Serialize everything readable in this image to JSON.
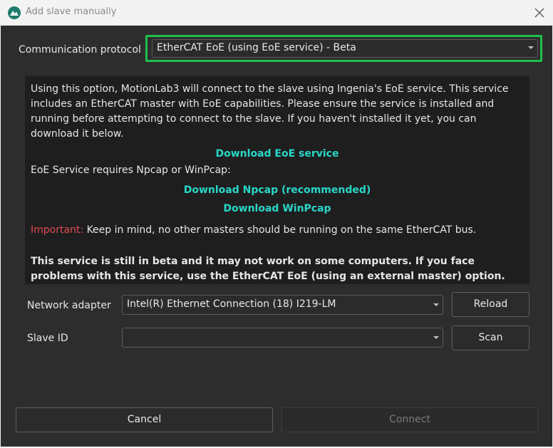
{
  "window": {
    "title": "Add slave manually"
  },
  "protocol": {
    "label": "Communication protocol",
    "value": "EtherCAT EoE (using EoE service) - Beta"
  },
  "info": {
    "intro": "Using this option, MotionLab3 will connect to the slave using Ingenia's EoE service. This service includes an EtherCAT master with EoE capabilities. Please ensure the service is installed and running before attempting to connect to the slave. If you haven't installed it yet, you can download it below.",
    "download_eoe": "Download EoE service",
    "requires": "EoE Service requires Npcap or WinPcap:",
    "download_npcap": "Download Npcap (recommended)",
    "download_winpcap": "Download WinPcap",
    "important_label": "Important:",
    "important_text": " Keep in mind, no other masters should be running on the same EtherCAT bus.",
    "beta_warning": "This service is still in beta and it may not work on some computers. If you face problems with this service, use the EtherCAT EoE (using an external master) option."
  },
  "network": {
    "label": "Network adapter",
    "value": "Intel(R) Ethernet Connection (18) I219-LM",
    "reload_label": "Reload"
  },
  "slave": {
    "label": "Slave ID",
    "value": "",
    "scan_label": "Scan"
  },
  "footer": {
    "cancel_label": "Cancel",
    "connect_label": "Connect"
  },
  "colors": {
    "accent_link": "#28d7c9",
    "important": "#e04a52",
    "highlight": "#1fbf4c",
    "background": "#2d2d2d"
  },
  "icons": {
    "app": "app-logo-icon",
    "close": "close-icon",
    "dropdown": "chevron-down-icon"
  }
}
